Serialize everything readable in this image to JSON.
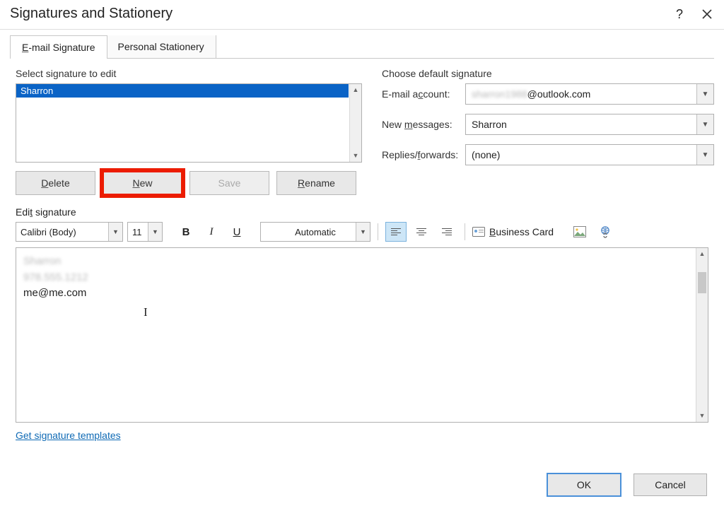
{
  "title": "Signatures and Stationery",
  "tabs": {
    "email": "E-mail Signature",
    "stationery": "Personal Stationery"
  },
  "left": {
    "label": "Select signature to edit",
    "selected_item": "Sharron",
    "buttons": {
      "delete": "Delete",
      "new": "New",
      "save": "Save",
      "rename": "Rename"
    }
  },
  "right": {
    "label": "Choose default signature",
    "account_label": "E-mail account:",
    "account_blur": "sharron1988",
    "account_suffix": "@outlook.com",
    "newmsg_label": "New messages:",
    "newmsg_value": "Sharron",
    "replies_label": "Replies/forwards:",
    "replies_value": "(none)"
  },
  "edit_label": "Edit signature",
  "toolbar": {
    "font": "Calibri (Body)",
    "size": "11",
    "color": "Automatic",
    "bizcard": "Business Card"
  },
  "editor": {
    "line1_blur": "Sharron",
    "line2_blur": "978.555.1212",
    "line3": "me@me.com"
  },
  "link_text": "Get signature templates",
  "ok": "OK",
  "cancel": "Cancel"
}
